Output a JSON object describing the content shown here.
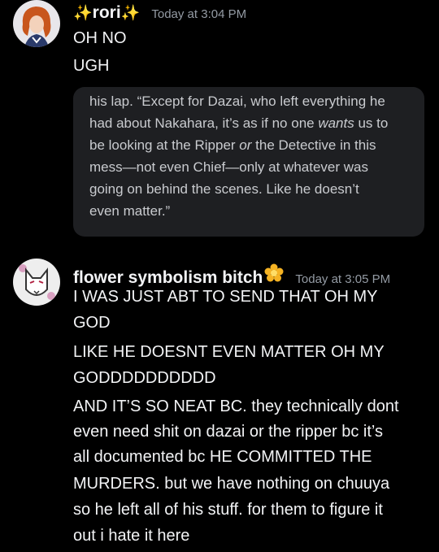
{
  "messages": [
    {
      "author": "rori",
      "sparkle_left": "✨",
      "sparkle_right": "✨",
      "timestamp": "Today at 3:04 PM",
      "lines": [
        "OH NO",
        "UGH"
      ],
      "quote_card": {
        "lines": [
          {
            "a": "his lap. “Except for Dazai, who left everything he",
            "em": "",
            "b": ""
          },
          {
            "a": "had about Nakahara, it’s as if no one ",
            "em": "wants",
            "b": " us to"
          },
          {
            "a": "be looking at the Ripper ",
            "em": "or",
            "b": " the Detective in this"
          },
          {
            "a": "mess—not even Chief—only at whatever was",
            "em": "",
            "b": ""
          },
          {
            "a": "going on behind the scenes. Like he doesn’t",
            "em": "",
            "b": ""
          },
          {
            "a": "even matter.”",
            "em": "",
            "b": ""
          }
        ]
      },
      "avatar_icon": "orange-haired-character-avatar"
    },
    {
      "author": "flower symbolism bitch",
      "author_badge_icon": "flower-emoji",
      "timestamp": "Today at 3:05 PM",
      "lines": [
        "I WAS JUST ABT TO SEND THAT OH MY",
        "GOD",
        "LIKE HE DOESNT EVEN MATTER OH MY",
        "GODDDDDDDDDD",
        "AND IT’S SO NEAT BC. they technically dont",
        "even need shit on dazai or the ripper bc it’s",
        "all documented bc HE COMMITTED THE",
        "MURDERS. but we have nothing on chuuya",
        "so he left all of his stuff. for them to figure it",
        "out i hate it here"
      ],
      "avatar_icon": "fox-mask-avatar"
    }
  ],
  "colors": {
    "background": "#000000",
    "text": "#f2f3f5",
    "timestamp": "#949ba4",
    "quote_bg": "#1e1f22",
    "quote_text": "#c9cbcf",
    "flower": "#f5b323"
  }
}
